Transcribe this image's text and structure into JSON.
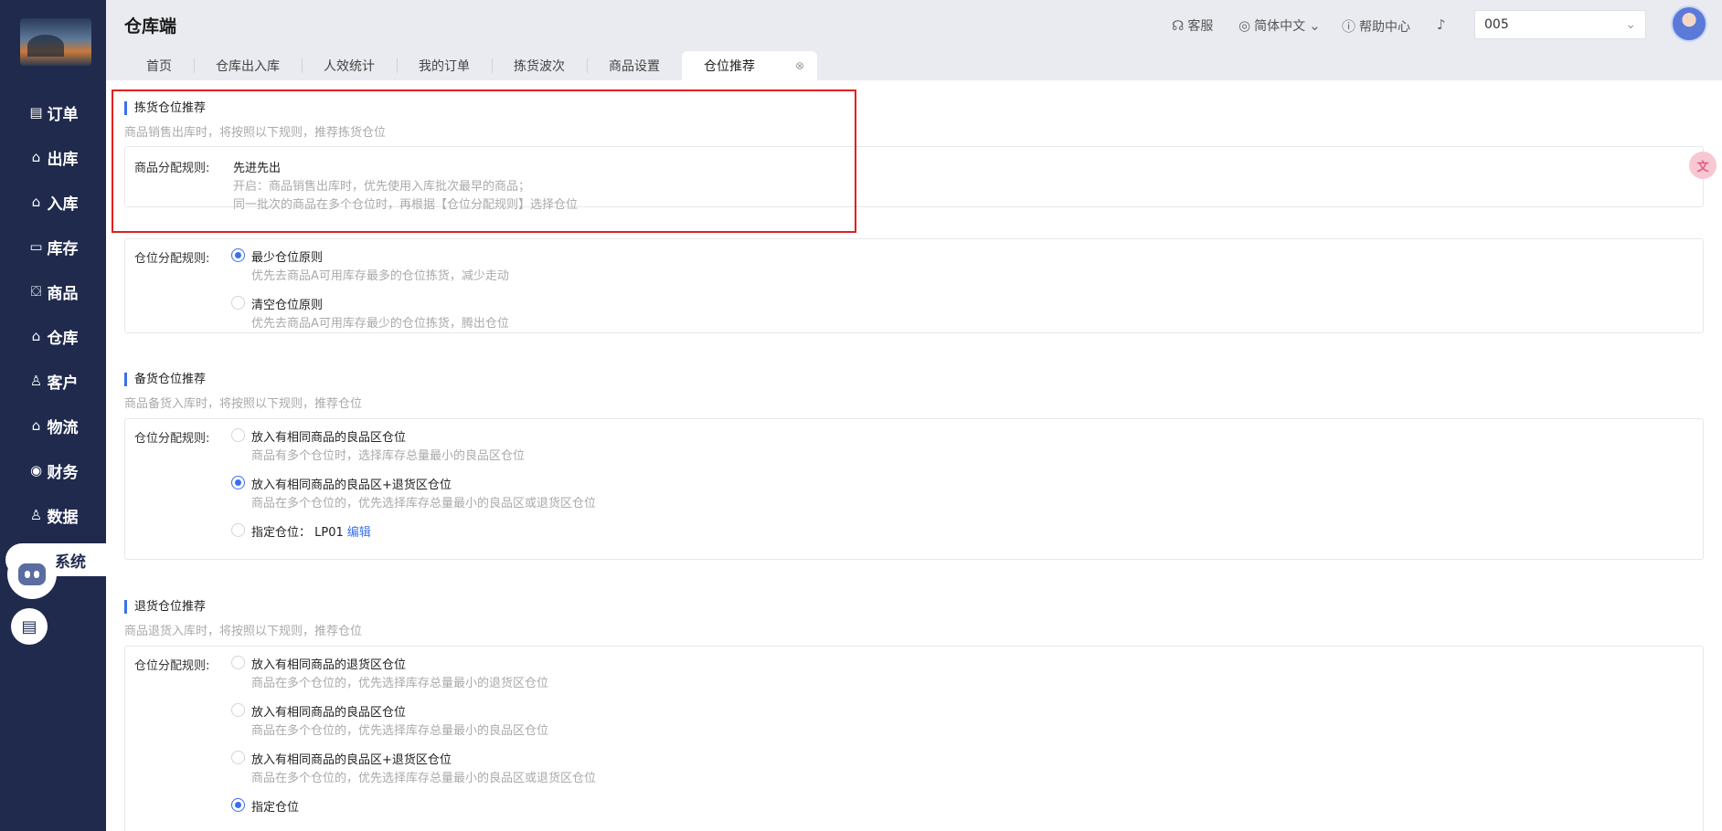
{
  "app": {
    "title": "仓库端"
  },
  "sidebar": {
    "items": [
      {
        "label": "订单",
        "icon": "▤"
      },
      {
        "label": "出库",
        "icon": "⌂"
      },
      {
        "label": "入库",
        "icon": "⌂"
      },
      {
        "label": "库存",
        "icon": "▭"
      },
      {
        "label": "商品",
        "icon": "⛋"
      },
      {
        "label": "仓库",
        "icon": "⌂"
      },
      {
        "label": "客户",
        "icon": "♙"
      },
      {
        "label": "物流",
        "icon": "⌂"
      },
      {
        "label": "财务",
        "icon": "◉"
      },
      {
        "label": "数据",
        "icon": "♙"
      },
      {
        "label": "系统",
        "icon": ""
      }
    ]
  },
  "header": {
    "service": "客服",
    "language": "简体中文",
    "help": "帮助中心",
    "store_value": "005"
  },
  "tabs": [
    "首页",
    "仓库出入库",
    "人效统计",
    "我的订单",
    "拣货波次",
    "商品设置",
    "仓位推荐"
  ],
  "picking": {
    "title": "拣货仓位推荐",
    "desc": "商品销售出库时，将按照以下规则，推荐拣货仓位",
    "goods_rule_label": "商品分配规则:",
    "goods_rule_value": "先进先出",
    "goods_rule_desc1": "开启：商品销售出库时，优先使用入库批次最早的商品；",
    "goods_rule_desc2": "同一批次的商品在多个仓位时，再根据【仓位分配规则】选择仓位",
    "loc_rule_label": "仓位分配规则:",
    "options": [
      {
        "title": "最少仓位原则",
        "desc": "优先去商品A可用库存最多的仓位拣货，减少走动",
        "checked": true
      },
      {
        "title": "清空仓位原则",
        "desc": "优先去商品A可用库存最少的仓位拣货，腾出仓位",
        "checked": false
      }
    ]
  },
  "stocking": {
    "title": "备货仓位推荐",
    "desc": "商品备货入库时，将按照以下规则，推荐仓位",
    "loc_rule_label": "仓位分配规则:",
    "options": [
      {
        "title": "放入有相同商品的良品区仓位",
        "desc": "商品有多个仓位时，选择库存总量最小的良品区仓位",
        "checked": false
      },
      {
        "title": "放入有相同商品的良品区+退货区仓位",
        "desc": "商品在多个仓位的，优先选择库存总量最小的良品区或退货区仓位",
        "checked": true
      },
      {
        "title": "指定仓位： LP01",
        "link": "编辑",
        "checked": false
      }
    ]
  },
  "returns": {
    "title": "退货仓位推荐",
    "desc": "商品退货入库时，将按照以下规则，推荐仓位",
    "loc_rule_label": "仓位分配规则:",
    "options": [
      {
        "title": "放入有相同商品的退货区仓位",
        "desc": "商品在多个仓位的，优先选择库存总量最小的退货区仓位",
        "checked": false
      },
      {
        "title": "放入有相同商品的良品区仓位",
        "desc": "商品在多个仓位的，优先选择库存总量最小的良品区仓位",
        "checked": false
      },
      {
        "title": "放入有相同商品的良品区+退货区仓位",
        "desc": "商品在多个仓位的，优先选择库存总量最小的良品区或退货区仓位",
        "checked": false
      },
      {
        "title": "指定仓位",
        "checked": true
      }
    ]
  },
  "colors": {
    "sidebar": "#1f2a4d",
    "accent": "#3a6ff0",
    "highlight": "#e02020"
  }
}
